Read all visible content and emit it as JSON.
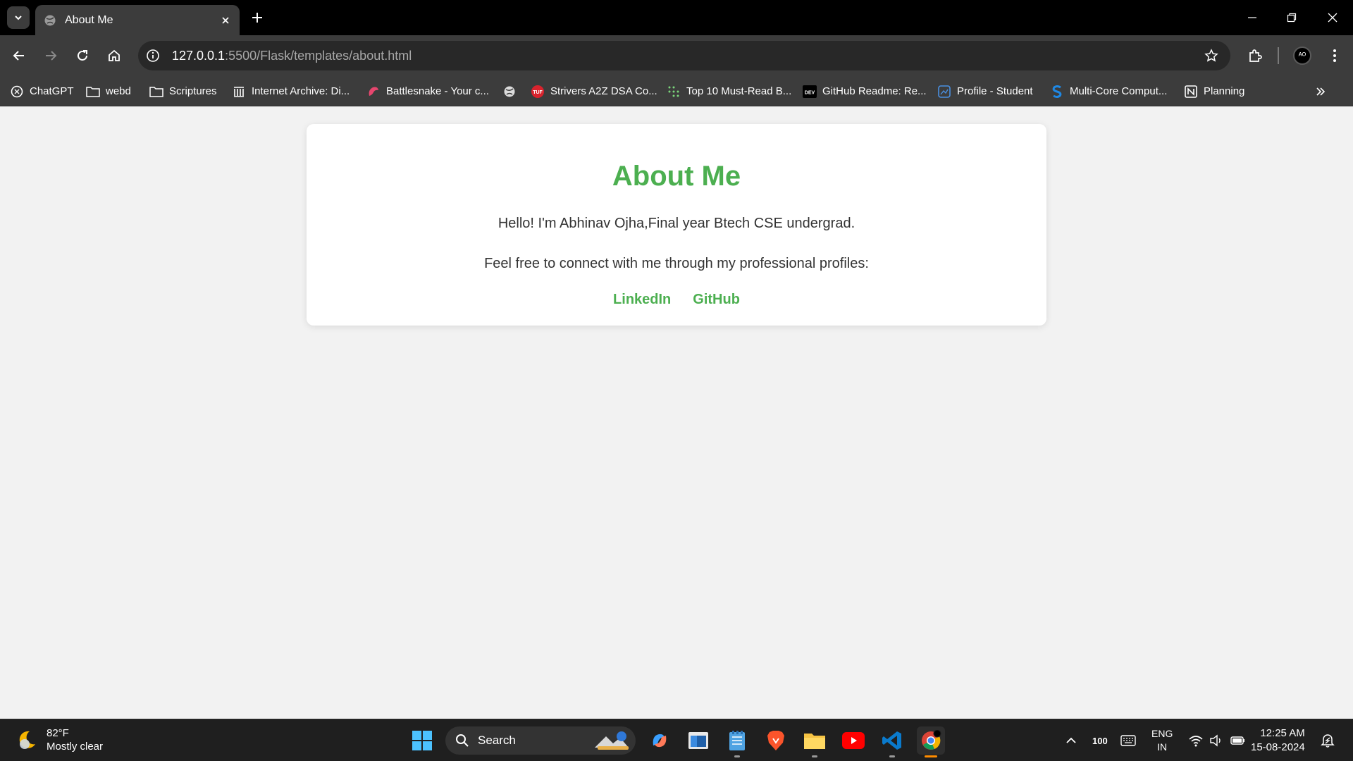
{
  "browser": {
    "tab": {
      "title": "About Me"
    },
    "address": {
      "host": "127.0.0.1",
      "path": ":5500/Flask/templates/about.html"
    },
    "profile_initial": "ᴬᴼ",
    "bookmarks": [
      {
        "label": "ChatGPT",
        "icon": "chatgpt-icon"
      },
      {
        "label": "webd",
        "icon": "folder-icon"
      },
      {
        "label": "Scriptures",
        "icon": "folder-icon"
      },
      {
        "label": "Internet Archive: Di...",
        "icon": "archive-icon"
      },
      {
        "label": "Battlesnake - Your c...",
        "icon": "battlesnake-icon"
      },
      {
        "label": "",
        "icon": "globe-icon"
      },
      {
        "label": "Strivers A2Z DSA Co...",
        "icon": "tuf-icon"
      },
      {
        "label": "Top 10 Must-Read B...",
        "icon": "dots-icon"
      },
      {
        "label": "GitHub Readme: Re...",
        "icon": "dev-icon"
      },
      {
        "label": "Profile - Student",
        "icon": "profile-icon"
      },
      {
        "label": "Multi-Core Comput...",
        "icon": "s-icon"
      },
      {
        "label": "Planning",
        "icon": "notion-icon"
      }
    ]
  },
  "page": {
    "heading": "About Me",
    "intro": "Hello! I'm Abhinav Ojha,Final year Btech CSE undergrad.",
    "connect": "Feel free to connect with me through my professional profiles:",
    "links": {
      "linkedin": "LinkedIn",
      "github": "GitHub"
    },
    "accent_color": "#4caf50"
  },
  "taskbar": {
    "weather": {
      "temp": "82°F",
      "desc": "Mostly clear"
    },
    "search_label": "Search",
    "battery": "100",
    "lang": {
      "line1": "ENG",
      "line2": "IN"
    },
    "time": "12:25 AM",
    "date": "15-08-2024"
  }
}
